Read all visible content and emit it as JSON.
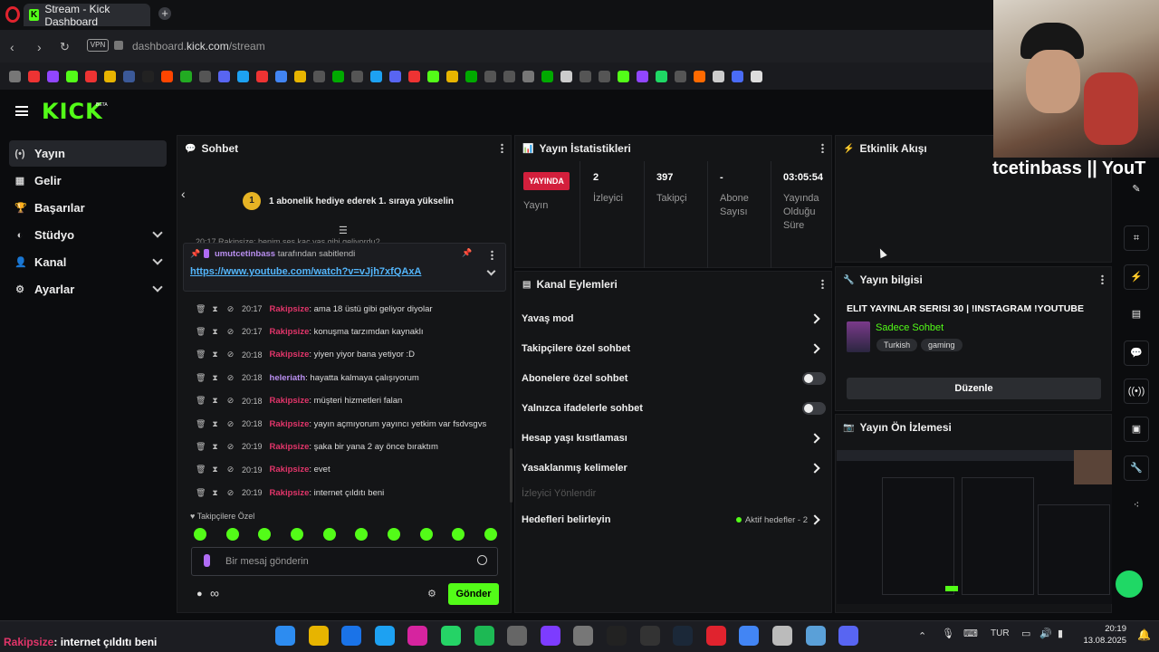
{
  "browser": {
    "tab_title": "Stream - Kick Dashboard",
    "tab_icon": "K",
    "new_tab": "+",
    "vpn": "VPN",
    "url_prefix": "dashboard.",
    "url_domain": "kick.com",
    "url_path": "/stream"
  },
  "kick": {
    "logo": "KICK",
    "beta": "BETA"
  },
  "sidebar": {
    "items": [
      {
        "label": "Yayın",
        "icon": "(•)"
      },
      {
        "label": "Gelir",
        "icon": "▦"
      },
      {
        "label": "Başarılar",
        "icon": "🏆"
      },
      {
        "label": "Stüdyo",
        "icon": "◐"
      },
      {
        "label": "Kanal",
        "icon": "👤"
      },
      {
        "label": "Ayarlar",
        "icon": "⚙"
      }
    ]
  },
  "chat": {
    "title": "Sohbet",
    "gift_badge": "1",
    "gift_text": "1 abonelik hediye ederek 1. sıraya yükselin",
    "partial_line": "20:17 Rakipsize: benim ses kaç yaş gibi geliyordu?",
    "pinned_user": "umutcetinbass",
    "pinned_suffix": "tarafından sabitlendi",
    "pinned_link": "https://www.youtube.com/watch?v=vJjh7xfQAxA",
    "messages": [
      {
        "time": "20:17",
        "user": "Rakipsize",
        "text": ": ama 18 üstü gibi geliyor diyolar"
      },
      {
        "time": "20:17",
        "user": "Rakipsize",
        "text": ": konuşma tarzımdan kaynaklı"
      },
      {
        "time": "20:18",
        "user": "Rakipsize",
        "text": ": yiyen yiyor bana yetiyor :D"
      },
      {
        "time": "20:18",
        "user": "heleriath",
        "text": ": hayatta kalmaya çalışıyorum"
      },
      {
        "time": "20:18",
        "user": "Rakipsize",
        "text": ": müşteri hizmetleri falan"
      },
      {
        "time": "20:18",
        "user": "Rakipsize",
        "text": ": yayın açmıyorum yayıncı yetkim var fsdvsgvs"
      },
      {
        "time": "20:19",
        "user": "Rakipsize",
        "text": ": şaka bir yana 2 ay önce bıraktım"
      },
      {
        "time": "20:19",
        "user": "Rakipsize",
        "text": ": evet"
      },
      {
        "time": "20:19",
        "user": "Rakipsize",
        "text": ": internet çıldıtı beni"
      }
    ],
    "followers_only": "♥ Takipçilere Özel",
    "input_placeholder": "Bir mesaj gönderin",
    "send_label": "Gönder",
    "infinity": "∞"
  },
  "stats": {
    "title": "Yayın İstatistikleri",
    "live_badge": "YAYINDA",
    "stream_label": "Yayın",
    "viewers_value": "2",
    "viewers_label": "İzleyici",
    "followers_value": "397",
    "followers_label": "Takipçi",
    "subs_value": "-",
    "subs_label": "Abone Sayısı",
    "uptime_value": "03:05:54",
    "uptime_label": "Yayında Olduğu Süre"
  },
  "actions": {
    "title": "Kanal Eylemleri",
    "items": [
      {
        "label": "Yavaş mod"
      },
      {
        "label": "Takipçilere özel sohbet"
      },
      {
        "label": "Abonelere özel sohbet"
      },
      {
        "label": "Yalnızca ifadelerle sohbet"
      },
      {
        "label": "Hesap yaşı kısıtlaması"
      },
      {
        "label": "Yasaklanmış kelimeler"
      },
      {
        "label": "İzleyici Yönlendir"
      },
      {
        "label": "Hedefleri belirleyin"
      }
    ],
    "goals_status": "Aktif hedefler - 2"
  },
  "activity": {
    "title": "Etkinlik Akışı"
  },
  "stream_info": {
    "title": "Yayın bilgisi",
    "stream_title": "ELIT YAYINLAR SERISI 30 | !INSTAGRAM !YOUTUBE",
    "category": "Sadece Sohbet",
    "tags": [
      "Turkish",
      "gaming"
    ],
    "edit_label": "Düzenle"
  },
  "preview": {
    "title": "Yayın Ön İzlemesi"
  },
  "overlay": {
    "webcam_text": "tcetinbass || YouT",
    "chat_alert_user": "Rakipsize",
    "chat_alert_text": ": internet çıldıtı beni"
  },
  "taskbar": {
    "lang": "TUR",
    "time": "20:19",
    "date": "13.08.2025"
  }
}
